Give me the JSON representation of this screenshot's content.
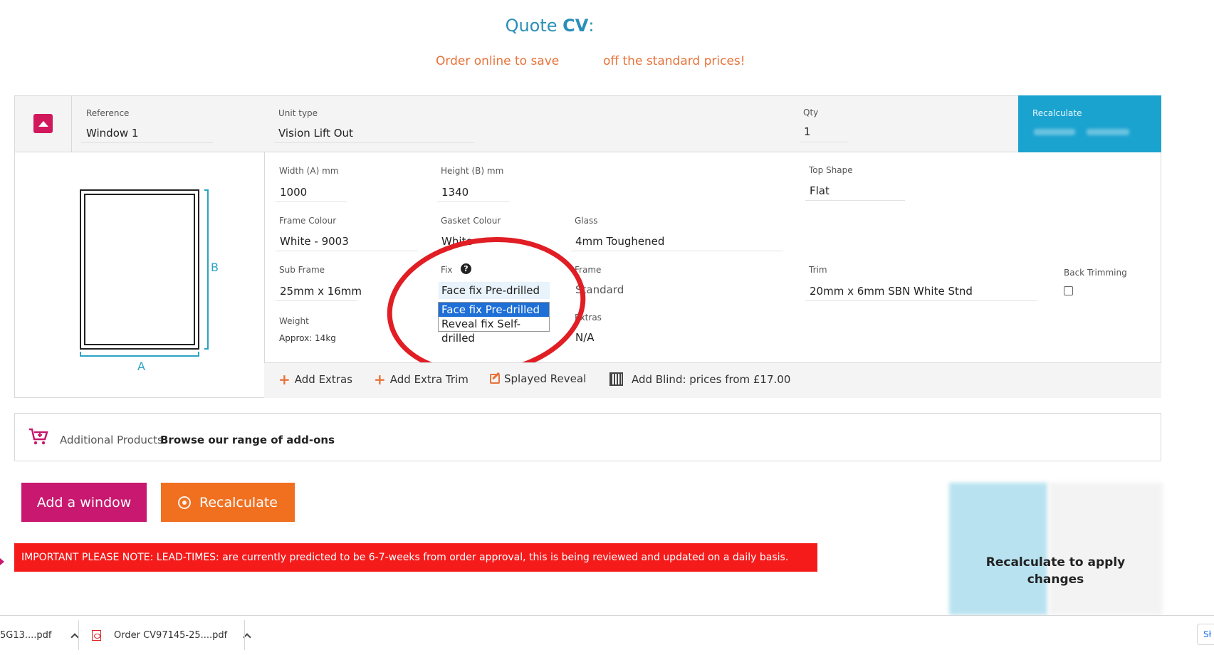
{
  "header": {
    "title_prefix": "Quote ",
    "title_code": "CV",
    "title_suffix": ":",
    "promo_left": "Order online to save",
    "promo_right": "off the standard prices!"
  },
  "window": {
    "reference_label": "Reference",
    "reference_value": "Window 1",
    "unit_type_label": "Unit type",
    "unit_type_value": "Vision Lift Out",
    "qty_label": "Qty",
    "qty_value": "1",
    "recalc_panel_label": "Recalculate",
    "width_label": "Width (A) mm",
    "width_value": "1000",
    "height_label": "Height (B) mm",
    "height_value": "1340",
    "top_shape_label": "Top Shape",
    "top_shape_value": "Flat",
    "frame_colour_label": "Frame Colour",
    "frame_colour_value": "White - 9003",
    "gasket_colour_label": "Gasket Colour",
    "gasket_colour_value": "White",
    "glass_label": "Glass",
    "glass_value": "4mm Toughened",
    "sub_frame_label": "Sub Frame",
    "sub_frame_value": "25mm x 16mm",
    "fix_label": "Fix",
    "fix_value": "Face fix Pre-drilled",
    "fix_options": [
      "Face fix Pre-drilled",
      "Reveal fix Self-drilled"
    ],
    "frame_label": "Frame",
    "frame_value": "Standard",
    "trim_label": "Trim",
    "trim_value": "20mm x 6mm SBN White Stnd",
    "back_trimming_label": "Back Trimming",
    "weight_label": "Weight",
    "weight_value": "Approx: 14kg",
    "extras_label": "Extras",
    "extras_value": "N/A",
    "dim_a": "A",
    "dim_b": "B"
  },
  "actions": {
    "add_extras": "Add Extras",
    "add_extra_trim": "Add Extra Trim",
    "splayed_reveal": "Splayed Reveal",
    "add_blind": "Add Blind: prices from £17.00"
  },
  "additional": {
    "label": "Additional Products",
    "link": "Browse our range of add-ons"
  },
  "buttons": {
    "add_window": "Add a window",
    "recalculate": "Recalculate"
  },
  "notice": "IMPORTANT PLEASE NOTE: LEAD-TIMES: are currently predicted to be 6-7-weeks from order approval, this is being reviewed and updated on a daily basis.",
  "summary": {
    "message": "Recalculate to apply changes"
  },
  "downloads": {
    "item1": "5G13....pdf",
    "item2": "Order CV97145-25....pdf",
    "show_all": "Sł"
  },
  "colors": {
    "brand_blue": "#1ba3d0",
    "brand_pink": "#c8186f",
    "brand_orange": "#f07020",
    "notice_red": "#f51b1b",
    "highlight_circle": "#e01e24"
  }
}
